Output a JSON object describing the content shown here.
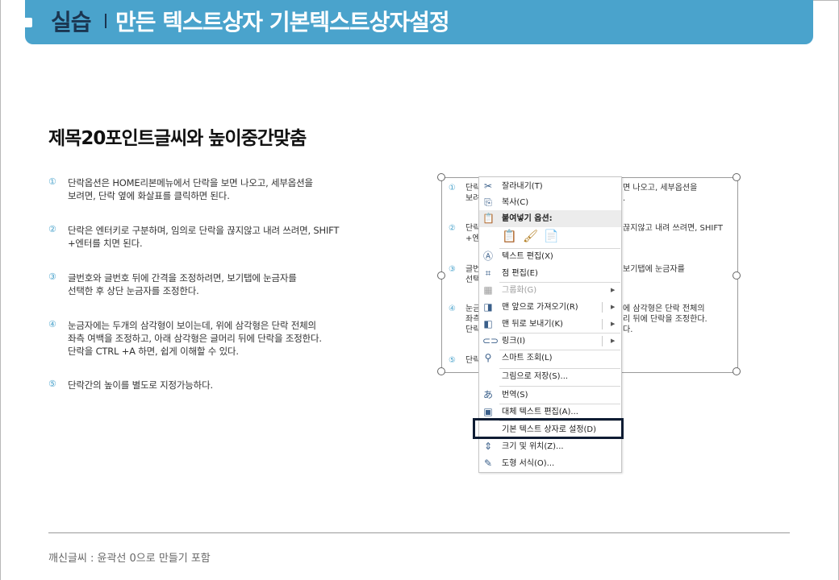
{
  "header": {
    "label": "실습",
    "title": "만든 텍스트상자 기본텍스트상자설정",
    "banner_color": "#4aa3cc"
  },
  "subtitle": "제목20포인트글씨와 높이중간맞춤",
  "list": [
    {
      "num": "①",
      "text": "단락옵션은 HOME리본메뉴에서 단락을 보면 나오고, 세부옵션을\n보려면, 단락 옆에 화살표를 클릭하면 된다."
    },
    {
      "num": "②",
      "text": "단락은 엔터키로 구분하며, 임의로 단락을 끊지않고 내려 쓰려면, SHIFT\n+엔터를 치면 된다."
    },
    {
      "num": "③",
      "text": "글번호와 글번호 뒤에 간격을 조정하려면, 보기탭에 눈금자를\n선택한 후 상단 눈금자를 조정한다."
    },
    {
      "num": "④",
      "text": "눈금자에는 두개의 삼각형이 보이는데, 위에 삼각형은 단락 전체의\n좌측 여백을 조정하고, 아래 삼각형은 글머리 뒤에 단락을 조정한다.\n단락을 CTRL +A 하면, 쉽게 이해할 수 있다."
    },
    {
      "num": "⑤",
      "text": "단락간의 높이를 별도로 지정가능하다."
    }
  ],
  "preview": {
    "lines": [
      {
        "num": "①",
        "left": "단락\n보려",
        "right": "면 나오고, 세부옵션을\n."
      },
      {
        "num": "②",
        "left": "단락\n+엔",
        "right": "끊지않고 내려 쓰려면, SHIFT"
      },
      {
        "num": "③",
        "left": "글번\n선택",
        "right": "보기탭에 눈금자를"
      },
      {
        "num": "④",
        "left": "눈금\n좌측\n단락",
        "right": "에 삼각형은 단락 전체의\n리 뒤에 단락을 조정한다.\n다."
      },
      {
        "num": "⑤",
        "left": "단락",
        "right": ""
      }
    ]
  },
  "context_menu": {
    "items": [
      {
        "id": "cut",
        "icon": "✂",
        "label": "잘라내기(T)"
      },
      {
        "id": "copy",
        "icon": "⎘",
        "label": "복사(C)"
      },
      {
        "id": "paste-options",
        "icon": "📋",
        "label": "붙여넣기 옵션:"
      },
      {
        "id": "edit-text",
        "icon": "Ⓐ",
        "label": "텍스트 편집(X)"
      },
      {
        "id": "edit-points",
        "icon": "⌗",
        "label": "점 편집(E)"
      },
      {
        "id": "group",
        "icon": "▦",
        "label": "그룹화(G)"
      },
      {
        "id": "bring-front",
        "icon": "◨",
        "label": "맨 앞으로 가져오기(R)"
      },
      {
        "id": "send-back",
        "icon": "◧",
        "label": "맨 뒤로 보내기(K)"
      },
      {
        "id": "link",
        "icon": "⊂⊃",
        "label": "링크(I)"
      },
      {
        "id": "smart-lookup",
        "icon": "⚲",
        "label": "스마트 조회(L)"
      },
      {
        "id": "save-as-picture",
        "icon": "",
        "label": "그림으로 저장(S)..."
      },
      {
        "id": "translate",
        "icon": "あ",
        "label": "번역(S)"
      },
      {
        "id": "alt-text",
        "icon": "▣",
        "label": "대체 텍스트 편집(A)..."
      },
      {
        "id": "set-default",
        "icon": "",
        "label": "기본 텍스트 상자로 설정(D)"
      },
      {
        "id": "size-position",
        "icon": "⇕",
        "label": "크기 및 위치(Z)..."
      },
      {
        "id": "format-shape",
        "icon": "✎",
        "label": "도형 서식(O)..."
      }
    ],
    "paste_icons": [
      "📋",
      "🖌",
      "📄"
    ]
  },
  "footer": {
    "text": "깨신글씨 : 윤곽선 0으로 만들기 포함"
  }
}
